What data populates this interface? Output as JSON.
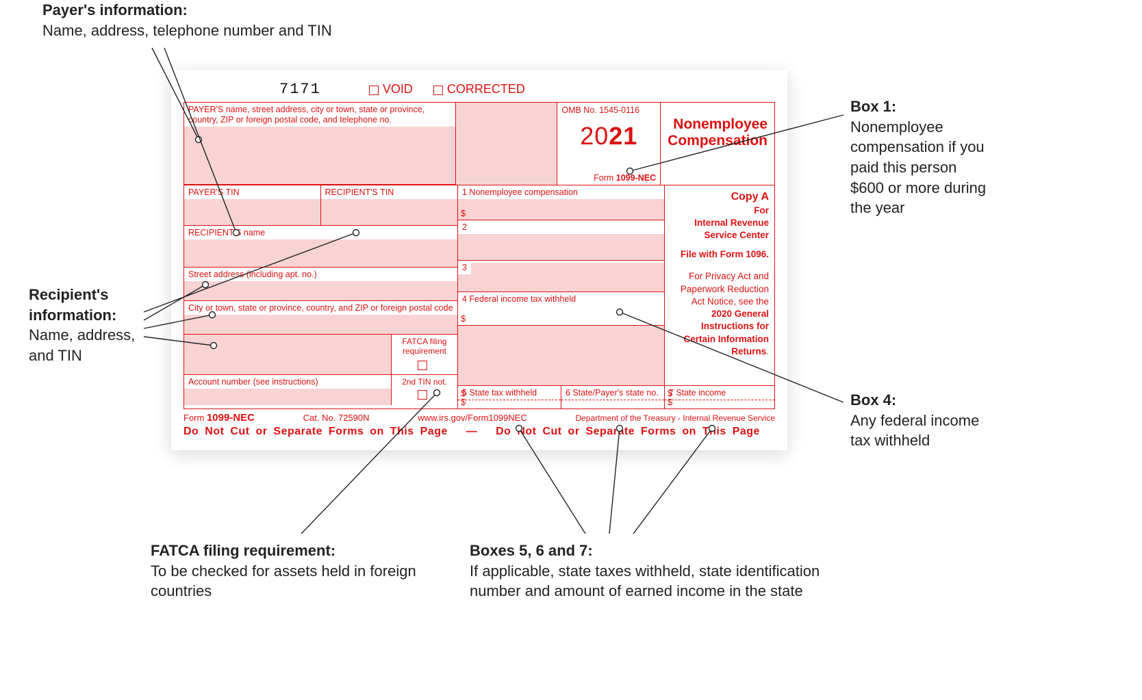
{
  "annotations": {
    "payer": {
      "title": "Payer's information:",
      "body": "Name, address, telephone number and TIN"
    },
    "recipient": {
      "title": "Recipient's information:",
      "body": "Name, address, and TIN"
    },
    "fatca": {
      "title": "FATCA filing requirement:",
      "body": "To be checked for assets held in foreign countries"
    },
    "box1": {
      "title": "Box 1:",
      "body": "Nonemployee compensation if you paid this person $600 or more during the year"
    },
    "box4": {
      "title": "Box 4:",
      "body": "Any federal income tax withheld"
    },
    "box567": {
      "title": "Boxes 5, 6 and 7:",
      "body": "If applicable, state taxes withheld, state identification number and amount of earned income in the state"
    }
  },
  "form": {
    "code": "7171",
    "void": "VOID",
    "corrected": "CORRECTED",
    "payer_block": "PAYER'S name, street address, city or town, state or province, country, ZIP or foreign postal code, and telephone no.",
    "omb": "OMB No. 1545-0116",
    "year_a": "20",
    "year_b": "21",
    "form_name_short": "Form 1099-NEC",
    "title": "Nonemployee Compensation",
    "box1_label": "1  Nonemployee compensation",
    "copy_a": "Copy A",
    "copy_for": "For",
    "copy_irs": "Internal Revenue Service Center",
    "file_with": "File with Form 1096.",
    "privacy": "For Privacy Act and Paperwork Reduction Act Notice, see the 2020 General Instructions for Certain Information Returns.",
    "payer_tin": "PAYER'S TIN",
    "recipient_tin": "RECIPIENT'S TIN",
    "box2": "2",
    "recipient_name": "RECIPIENT'S name",
    "box3": "3",
    "street": "Street address (including apt. no.)",
    "box4_label": "4  Federal income tax withheld",
    "city": "City or town, state or province, country, and ZIP or foreign postal code",
    "fatca_label": "FATCA filing requirement",
    "account": "Account number (see instructions)",
    "second_tin": "2nd TIN not.",
    "box5": "5  State tax withheld",
    "box6": "6  State/Payer's state no.",
    "box7": "7  State income",
    "cat": "Cat. No. 72590N",
    "url": "www.irs.gov/Form1099NEC",
    "dept": "Department of the Treasury - Internal Revenue Service",
    "donotcut_a": "Do  Not  Cut  or  Separate  Forms  on  This  Page",
    "dash": "—",
    "donotcut_b": "Do  Not  Cut  or  Separate  Forms  on  This  Page"
  }
}
